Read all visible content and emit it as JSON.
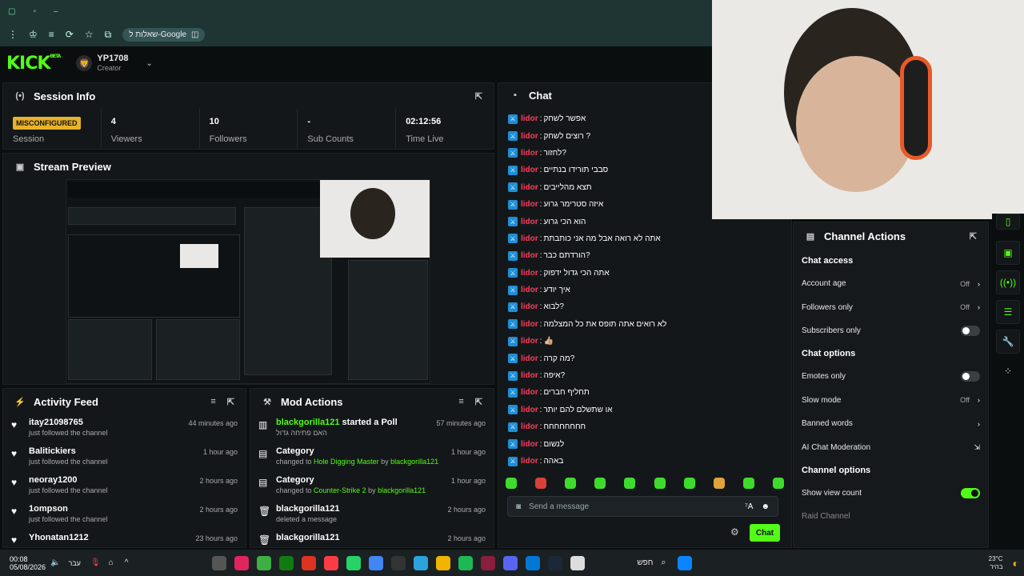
{
  "browser": {
    "search_chip": "שאלות ל-Google"
  },
  "header": {
    "logo": "KICK",
    "logo_tag": "BETA",
    "username": "YP1708",
    "role": "Creator"
  },
  "session_info": {
    "title": "Session Info",
    "status_badge": "MISCONFIGURED",
    "session_label": "Session",
    "stats": [
      {
        "value": "4",
        "label": "Viewers"
      },
      {
        "value": "10",
        "label": "Followers"
      },
      {
        "value": "-",
        "label": "Sub Counts"
      },
      {
        "value": "02:12:56",
        "label": "Time Live"
      }
    ]
  },
  "stream_preview": {
    "title": "Stream Preview"
  },
  "activity_feed": {
    "title": "Activity Feed",
    "items": [
      {
        "name": "itay21098765",
        "action": "just followed the channel",
        "time": "44 minutes ago"
      },
      {
        "name": "Balitickiers",
        "action": "just followed the channel",
        "time": "1 hour ago"
      },
      {
        "name": "neoray1200",
        "action": "just followed the channel",
        "time": "2 hours ago"
      },
      {
        "name": "1ompson",
        "action": "just followed the channel",
        "time": "2 hours ago"
      },
      {
        "name": "Yhonatan1212",
        "action": "",
        "time": "23 hours ago"
      }
    ]
  },
  "mod_actions": {
    "title": "Mod Actions",
    "items": [
      {
        "title_user": "blackgorilla121",
        "title_rest": " started a Poll",
        "detail": "האם פתיחה גדול",
        "detail_target": "",
        "detail_by": "",
        "time": "57 minutes ago",
        "icon": "poll-icon"
      },
      {
        "title_user": "",
        "title_rest": "Category",
        "detail": "changed to ",
        "detail_target": "Hole Digging Master",
        "detail_by": "blackgorilla121",
        "time": "1 hour ago",
        "icon": "category-icon"
      },
      {
        "title_user": "",
        "title_rest": "Category",
        "detail": "changed to ",
        "detail_target": "Counter-Strike 2",
        "detail_by": "blackgorilla121",
        "time": "1 hour ago",
        "icon": "category-icon"
      },
      {
        "title_user": "",
        "title_rest": "blackgorilla121",
        "detail": "deleted a message",
        "detail_target": "",
        "detail_by": "",
        "time": "2 hours ago",
        "icon": "trash-icon"
      },
      {
        "title_user": "",
        "title_rest": "blackgorilla121",
        "detail": "",
        "detail_target": "",
        "detail_by": "",
        "time": "2 hours ago",
        "icon": "trash-icon"
      }
    ],
    "by_word": " by "
  },
  "chat": {
    "title": "Chat",
    "messages": [
      {
        "user": "lidor",
        "text": "אפשר לשחק"
      },
      {
        "user": "lidor",
        "text": "רוצים לשחק ?"
      },
      {
        "user": "lidor",
        "text": "לחזור?"
      },
      {
        "user": "lidor",
        "text": "סבבי תורידו בנתיים"
      },
      {
        "user": "lidor",
        "text": "תצא מהלייבים"
      },
      {
        "user": "lidor",
        "text": "איזה סטרימר גרוע"
      },
      {
        "user": "lidor",
        "text": "הוא הכי גרוע"
      },
      {
        "user": "lidor",
        "text": "אתה לא רואה אבל מה אני כותבתת"
      },
      {
        "user": "lidor",
        "text": "הורדתם כבר?"
      },
      {
        "user": "lidor",
        "text": "אתה הכי גדול ידפוק"
      },
      {
        "user": "lidor",
        "text": "איך יודע"
      },
      {
        "user": "lidor",
        "text": "לבוא?"
      },
      {
        "user": "lidor",
        "text": "לא רואים אתה תופס את כל המצלמה"
      },
      {
        "user": "lidor",
        "text": "👍🏼"
      },
      {
        "user": "lidor",
        "text": "מה קרה?"
      },
      {
        "user": "lidor",
        "text": "איפה?"
      },
      {
        "user": "lidor",
        "text": "תחליף חברים"
      },
      {
        "user": "lidor",
        "text": "או שתשלם להם יותר"
      },
      {
        "user": "lidor",
        "text": "חחחחחחחח"
      },
      {
        "user": "lidor",
        "text": "לנשום"
      },
      {
        "user": "lidor",
        "text": "באהה"
      }
    ],
    "input_placeholder": "Send a message",
    "send_label": "Chat"
  },
  "channel_actions": {
    "title": "Channel Actions",
    "sections": [
      {
        "heading": "Chat access",
        "rows": [
          {
            "label": "Account age",
            "value": "Off",
            "kind": "chevron"
          },
          {
            "label": "Followers only",
            "value": "Off",
            "kind": "chevron"
          },
          {
            "label": "Subscribers only",
            "value": "",
            "kind": "toggle-off"
          }
        ]
      },
      {
        "heading": "Chat options",
        "rows": [
          {
            "label": "Emotes only",
            "value": "",
            "kind": "toggle-off"
          },
          {
            "label": "Slow mode",
            "value": "Off",
            "kind": "chevron"
          },
          {
            "label": "Banned words",
            "value": "",
            "kind": "chevron"
          },
          {
            "label": "AI Chat Moderation",
            "value": "",
            "kind": "external"
          }
        ]
      },
      {
        "heading": "Channel options",
        "rows": [
          {
            "label": "Show view count",
            "value": "",
            "kind": "toggle-on"
          },
          {
            "label": "Raid Channel",
            "value": "",
            "kind": "muted"
          }
        ]
      }
    ]
  },
  "taskbar": {
    "time": "00:08",
    "date": "05/08/2026",
    "lang": "עבר",
    "search": "חפש",
    "weather_temp": "23°C",
    "weather_desc": "בהיר"
  },
  "colors": {
    "kick_green": "#53fc18",
    "chat_user": "#ff3b5c",
    "badge_yellow": "#e9b329",
    "mod_badge": "#1f8ed6"
  }
}
